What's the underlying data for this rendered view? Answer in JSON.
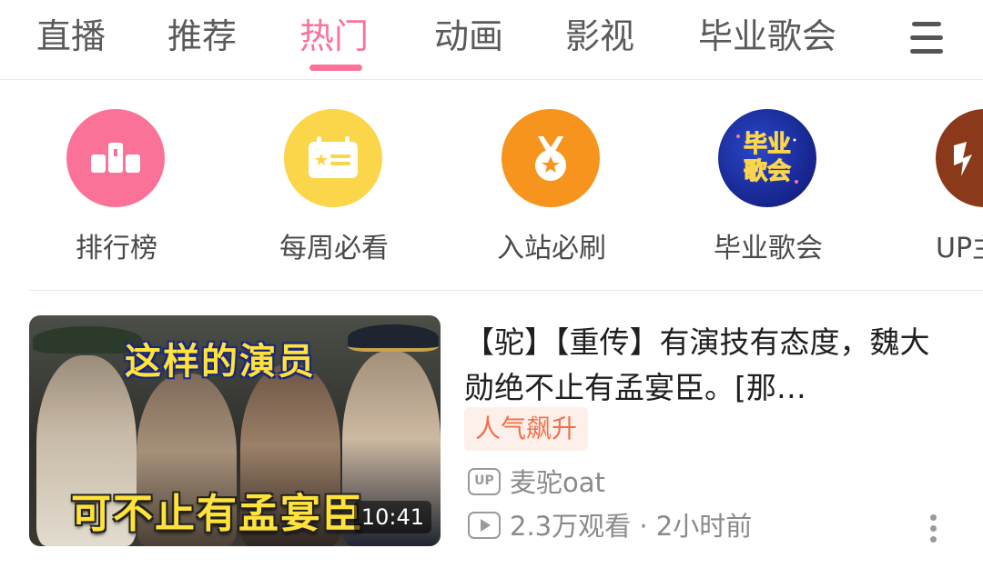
{
  "tabs": [
    {
      "label": "直播",
      "active": false
    },
    {
      "label": "推荐",
      "active": false
    },
    {
      "label": "热门",
      "active": true
    },
    {
      "label": "动画",
      "active": false
    },
    {
      "label": "影视",
      "active": false
    },
    {
      "label": "毕业歌会",
      "active": false
    }
  ],
  "menu_icon": "hamburger-menu-icon",
  "colors": {
    "accent": "#fb7299",
    "ranking": "#fb7299",
    "weekly": "#fbd54a",
    "must_watch": "#f7941d",
    "graduation": "#1a2fa0",
    "up": "#8a3a1a"
  },
  "entries": [
    {
      "label": "排行榜",
      "icon": "ranking-podium-icon"
    },
    {
      "label": "每周必看",
      "icon": "weekly-calendar-icon"
    },
    {
      "label": "入站必刷",
      "icon": "medal-icon"
    },
    {
      "label": "毕业歌会",
      "icon": "graduation-concert-logo",
      "logo_text": "毕业\n歌会"
    },
    {
      "label": "UP主",
      "icon": "up-creator-icon"
    }
  ],
  "video": {
    "title": "【驼】【重传】有演技有态度，魏大勋绝不止有孟宴臣。[那…",
    "thumbnail_text_top": "这样的演员",
    "thumbnail_text_bottom": "可不止有孟宴臣",
    "duration": "10:41",
    "badge": "人气飙升",
    "up_icon_text": "UP",
    "uploader": "麦驼oat",
    "stats": "2.3万观看 · 2小时前"
  }
}
